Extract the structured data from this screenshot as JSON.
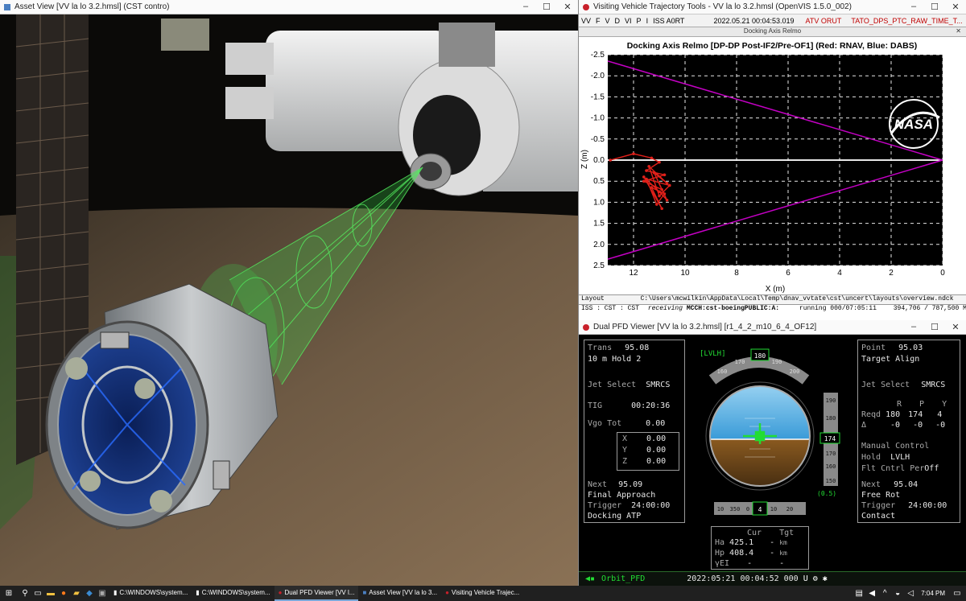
{
  "asset_window": {
    "title": "Asset View [VV la lo 3.2.hmsl] (CST contro)"
  },
  "traj_window": {
    "title": "Visiting Vehicle Trajectory Tools - VV la lo 3.2.hmsl (OpenVIS 1.5.0_002)",
    "menu": {
      "items": [
        "VV",
        "F",
        "V",
        "D",
        "VI",
        "P",
        "I"
      ],
      "iss": "ISS A0RT",
      "time": "2022.05.21 00:04:53.019",
      "atv": "ATV ORUT",
      "tato": "TATO_DPS_PTC_RAW_TIME_T..."
    },
    "subtitle": "Docking Axis Relmo",
    "status": {
      "layout_label": "Layout",
      "layout_path": "C:\\Users\\mcwilkin\\AppData\\Local\\Temp\\dnav_vvtate\\cst\\uncert\\layouts\\overview.ndck",
      "iss_label": "ISS : CST : CST",
      "receiving": "receiving",
      "receiving_from": "MCCH:cst-boeingPUBLIC:A:",
      "running": "running 000/07:05:11",
      "mem": "394,706 / 787,500 MB"
    }
  },
  "chart_data": {
    "type": "line",
    "title": "Docking Axis Relmo [DP-DP Post-IF2/Pre-OF1] (Red: RNAV, Blue: DABS)",
    "xlabel": "X (m)",
    "ylabel": "Z (m)",
    "xlim": [
      13,
      0
    ],
    "ylim": [
      -2.5,
      2.5
    ],
    "x_ticks": [
      12,
      10,
      8,
      6,
      4,
      2,
      0
    ],
    "y_ticks": [
      -2.5,
      -2.0,
      -1.5,
      -1.0,
      -0.5,
      0.0,
      0.5,
      1.0,
      1.5,
      2.0,
      2.5
    ],
    "y_tick_labels": [
      "-2.5",
      "-2.0",
      "-1.5",
      "-1.0",
      "-0.5",
      "0.0",
      "0.5",
      "1.0",
      "1.5",
      "2.0",
      "2.5"
    ],
    "grid": true,
    "cone": [
      {
        "name": "",
        "x": [
          13,
          0
        ],
        "y": [
          -2.35,
          0.0
        ]
      },
      {
        "name": "",
        "x": [
          13,
          0
        ],
        "y": [
          2.35,
          0.0
        ]
      }
    ],
    "trace": {
      "name": "",
      "x": [
        12.9,
        12.0,
        11.3,
        11.0,
        11.5,
        10.8,
        11.6,
        10.9,
        11.2,
        10.7,
        11.4,
        11.0,
        10.6,
        11.5,
        11.1,
        10.8,
        11.3,
        10.9,
        11.6,
        11.0,
        10.7,
        11.2
      ],
      "y": [
        0.0,
        -0.15,
        -0.05,
        0.05,
        0.25,
        0.35,
        0.5,
        0.7,
        0.3,
        0.55,
        0.15,
        0.85,
        0.6,
        0.45,
        1.05,
        0.8,
        0.65,
        1.15,
        0.4,
        0.75,
        0.95,
        0.3
      ]
    },
    "colors": {
      "cone": "#c400c4",
      "trace": "#e0201a",
      "axis": "#ffffff",
      "grid": "#ffffff",
      "bg": "#000000"
    }
  },
  "pfd_window": {
    "title": "Dual PFD Viewer [VV la lo 3.2.hmsl] [r1_4_2_m10_6_4_OF12]",
    "left": {
      "trans_label": "Trans",
      "trans_value": "95.08",
      "hold": "10 m Hold 2",
      "jet_label": "Jet Select",
      "jet_value": "SMRCS",
      "tig_label": "TIG",
      "tig_value": "00:20:36",
      "vgo_label": "Vgo Tot",
      "vgo_value": "0.00",
      "vx_label": "X",
      "vx": "0.00",
      "vy_label": "Y",
      "vy": "0.00",
      "vz_label": "Z",
      "vz": "0.00",
      "next_label": "Next",
      "next_value": "95.09",
      "next_name": "Final Approach",
      "trigger_label": "Trigger",
      "trigger_value": "24:00:00",
      "trigger_name": "Docking ATP"
    },
    "center": {
      "frame": "[LVLH]",
      "heading_ticks": [
        "160",
        "170",
        "180",
        "190",
        "200"
      ],
      "heading_value": "180",
      "pitch_ticks": [
        "190",
        "180",
        "170",
        "160",
        "150"
      ],
      "pitch_value": "174",
      "roll_ticks": [
        "350",
        "0",
        "10",
        "20"
      ],
      "roll_left": "10",
      "roll_value": "4",
      "rate": "(0.5)",
      "cur_label": "Cur",
      "tgt_label": "Tgt",
      "ha_label": "Ha",
      "ha_cur": "425.1",
      "ha_tgt": "-",
      "ha_unit": "km",
      "hp_label": "Hp",
      "hp_cur": "408.4",
      "hp_tgt": "-",
      "hp_unit": "km",
      "yei_label": "γEI",
      "yei_cur": "-",
      "yei_tgt": "-"
    },
    "right": {
      "point_label": "Point",
      "point_value": "95.03",
      "point_name": "Target Align",
      "jet_label": "Jet Select",
      "jet_value": "SMRCS",
      "r_label": "R",
      "p_label": "P",
      "y_label": "Y",
      "reqd_label": "Reqd",
      "reqd_r": "180",
      "reqd_p": "174",
      "reqd_y": "4",
      "delta_label": "Δ",
      "delta_r": "-0",
      "delta_p": "-0",
      "delta_y": "-0",
      "manual_label": "Manual Control",
      "hold_label": "Hold",
      "hold_value": "LVLH",
      "flt_label": "Flt Cntrl Per",
      "flt_value": "Off",
      "next_label": "Next",
      "next_value": "95.04",
      "next_name": "Free Rot",
      "trigger_label": "Trigger",
      "trigger_value": "24:00:00",
      "trigger_name": "Contact"
    },
    "bottom": {
      "orbit": "Orbit_PFD",
      "time": "2022:05:21 00:04:52 000"
    }
  },
  "taskbar": {
    "items": [
      {
        "label": "C:\\WINDOWS\\system...",
        "active": false
      },
      {
        "label": "C:\\WINDOWS\\system...",
        "active": false
      },
      {
        "label": "Dual PFD Viewer [VV l...",
        "active": true
      },
      {
        "label": "Asset View [VV la lo 3...",
        "active": false
      },
      {
        "label": "Visiting Vehicle Trajec...",
        "active": false
      }
    ],
    "clock": "7:04 PM"
  }
}
